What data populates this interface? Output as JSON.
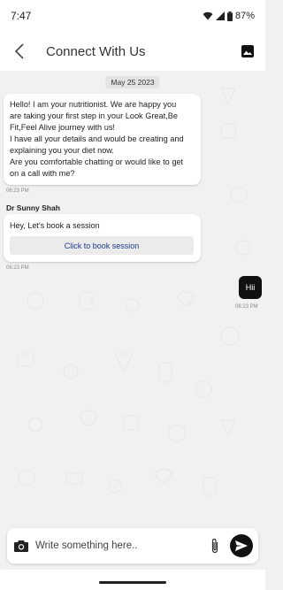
{
  "status_bar": {
    "time": "7:47",
    "battery": "87%",
    "icons": [
      "wifi-icon",
      "signal-icon",
      "battery-icon"
    ]
  },
  "header": {
    "title": "Connect With Us",
    "back_icon": "chevron-left-icon",
    "image_icon": "image-icon"
  },
  "chat": {
    "date": "May 25 2023",
    "messages": [
      {
        "lines": [
          "Hello! I am your nutritionist. We are happy you",
          "are taking your first step in your Look Great,Be",
          "Fit,Feel Alive journey with us!",
          "I have all your details and would be creating and",
          "explaining you your diet now.",
          "Are you comfortable chatting or would like to get",
          "on a call with me?"
        ],
        "time": "06:23 PM"
      },
      {
        "sender": "Dr Sunny Shah",
        "text": "Hey, Let's book a session",
        "button_label": "Click to book session",
        "time": "06:23 PM"
      },
      {
        "text": "Hii",
        "time": "06:23 PM"
      }
    ]
  },
  "composer": {
    "placeholder": "Write something here..",
    "icons": [
      "camera-icon",
      "paperclip-icon",
      "send-icon"
    ]
  },
  "colors": {
    "background": "#f1f1f1",
    "outgoing_bubble": "#111111",
    "button_text": "#1d3a8a"
  }
}
